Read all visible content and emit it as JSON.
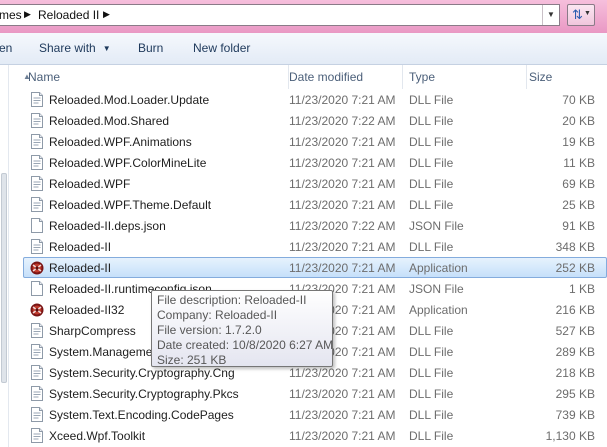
{
  "address_bar": {
    "crumbs": [
      "mes",
      "Reloaded II"
    ]
  },
  "toolbar": {
    "partial_left_label": "en",
    "share_label": "Share with",
    "burn_label": "Burn",
    "new_folder_label": "New folder"
  },
  "columns": {
    "name": "Name",
    "date": "Date modified",
    "type": "Type",
    "size": "Size"
  },
  "files": [
    {
      "name": "Reloaded.Mod.Loader.Update",
      "date": "11/23/2020 7:21 AM",
      "type": "DLL File",
      "size": "70 KB",
      "icon": "dll-file-icon"
    },
    {
      "name": "Reloaded.Mod.Shared",
      "date": "11/23/2020 7:22 AM",
      "type": "DLL File",
      "size": "20 KB",
      "icon": "dll-file-icon"
    },
    {
      "name": "Reloaded.WPF.Animations",
      "date": "11/23/2020 7:21 AM",
      "type": "DLL File",
      "size": "19 KB",
      "icon": "dll-file-icon"
    },
    {
      "name": "Reloaded.WPF.ColorMineLite",
      "date": "11/23/2020 7:21 AM",
      "type": "DLL File",
      "size": "11 KB",
      "icon": "dll-file-icon"
    },
    {
      "name": "Reloaded.WPF",
      "date": "11/23/2020 7:21 AM",
      "type": "DLL File",
      "size": "69 KB",
      "icon": "dll-file-icon"
    },
    {
      "name": "Reloaded.WPF.Theme.Default",
      "date": "11/23/2020 7:21 AM",
      "type": "DLL File",
      "size": "25 KB",
      "icon": "dll-file-icon"
    },
    {
      "name": "Reloaded-II.deps.json",
      "date": "11/23/2020 7:22 AM",
      "type": "JSON File",
      "size": "91 KB",
      "icon": "json-file-icon"
    },
    {
      "name": "Reloaded-II",
      "date": "11/23/2020 7:21 AM",
      "type": "DLL File",
      "size": "348 KB",
      "icon": "dll-file-icon"
    },
    {
      "name": "Reloaded-II",
      "date": "11/23/2020 7:21 AM",
      "type": "Application",
      "size": "252 KB",
      "icon": "app-icon",
      "selected": true
    },
    {
      "name": "Reloaded-II.runtimeconfig.json",
      "date": "11/23/2020 7:21 AM",
      "type": "JSON File",
      "size": "1 KB",
      "icon": "json-file-icon"
    },
    {
      "name": "Reloaded-II32",
      "date": "11/23/2020 7:21 AM",
      "type": "Application",
      "size": "216 KB",
      "icon": "app-icon"
    },
    {
      "name": "SharpCompress",
      "date": "11/23/2020 7:21 AM",
      "type": "DLL File",
      "size": "527 KB",
      "icon": "dll-file-icon"
    },
    {
      "name": "System.Management",
      "date": "11/23/2020 7:21 AM",
      "type": "DLL File",
      "size": "289 KB",
      "icon": "dll-file-icon"
    },
    {
      "name": "System.Security.Cryptography.Cng",
      "date": "11/23/2020 7:21 AM",
      "type": "DLL File",
      "size": "218 KB",
      "icon": "dll-file-icon"
    },
    {
      "name": "System.Security.Cryptography.Pkcs",
      "date": "11/23/2020 7:21 AM",
      "type": "DLL File",
      "size": "295 KB",
      "icon": "dll-file-icon"
    },
    {
      "name": "System.Text.Encoding.CodePages",
      "date": "11/23/2020 7:21 AM",
      "type": "DLL File",
      "size": "739 KB",
      "icon": "dll-file-icon"
    },
    {
      "name": "Xceed.Wpf.Toolkit",
      "date": "11/23/2020 7:21 AM",
      "type": "DLL File",
      "size": "1,130 KB",
      "icon": "dll-file-icon"
    }
  ],
  "tooltip": {
    "lines": [
      "File description: Reloaded-II",
      "Company: Reloaded-II",
      "File version: 1.7.2.0",
      "Date created: 10/8/2020 6:27 AM",
      "Size: 251 KB"
    ]
  },
  "colors": {
    "title_bar": "#e998c4",
    "selection_border": "#84acdd",
    "selection_fill": "#c6e0fa",
    "header_text": "#4c607a"
  }
}
